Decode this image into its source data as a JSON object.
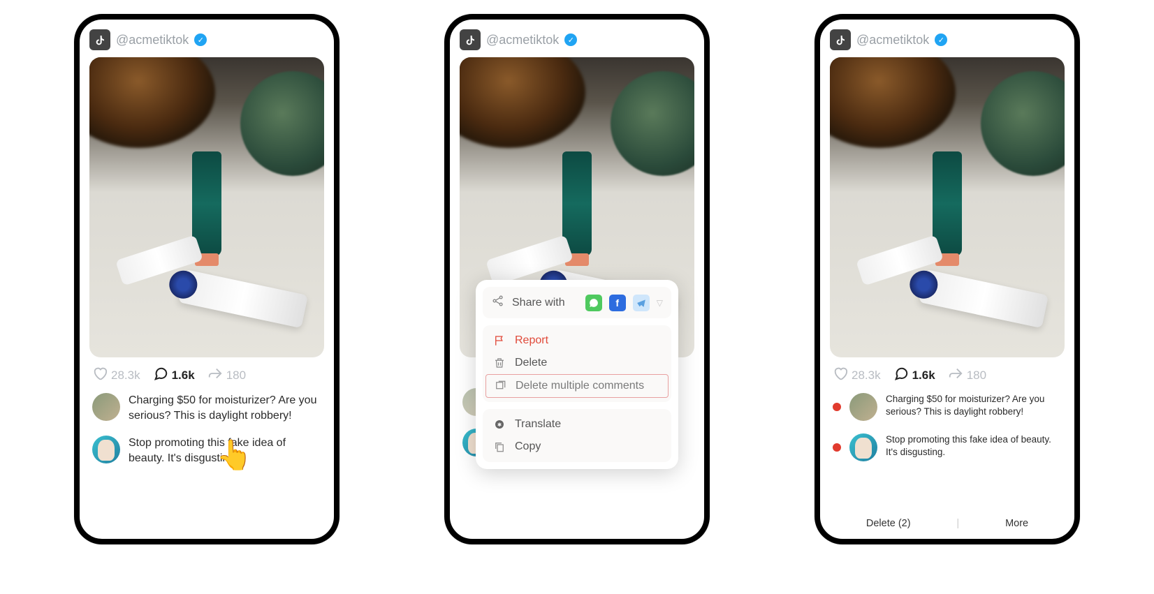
{
  "username": "@acmetiktok",
  "stats": {
    "likes": "28.3k",
    "comments": "1.6k",
    "shares": "180"
  },
  "comments": [
    {
      "text": "Charging $50 for moisturizer? Are you serious? This is daylight robbery!"
    },
    {
      "text": "Stop promoting this fake idea of beauty. It's disgusting."
    }
  ],
  "popup": {
    "share_label": "Share with",
    "report": "Report",
    "delete": "Delete",
    "delete_multiple": "Delete multiple comments",
    "translate": "Translate",
    "copy": "Copy"
  },
  "bottom_bar": {
    "delete_label": "Delete (2)",
    "more_label": "More"
  }
}
